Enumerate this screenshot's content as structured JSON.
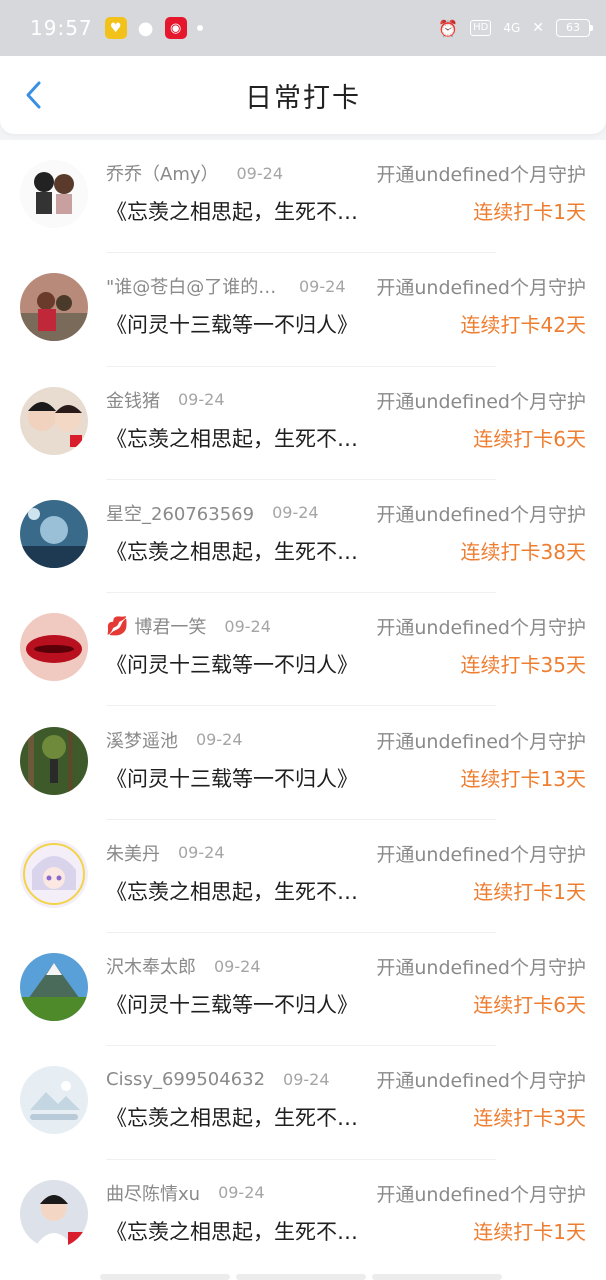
{
  "status_bar": {
    "time": "19:57",
    "network_badge": "HD",
    "signal": "4G",
    "battery": "63",
    "icons": [
      "tmall-icon",
      "wechat-icon",
      "weibo-icon",
      "alarm-icon",
      "hd-icon",
      "signal-4g-icon",
      "wifi-off-icon",
      "battery-icon"
    ]
  },
  "header": {
    "back_icon": "chevron-left-icon",
    "title": "日常打卡"
  },
  "colors": {
    "accent_back": "#3a8ee6",
    "streak": "#ee7d30",
    "muted": "#8a8a8a"
  },
  "items": [
    {
      "name": "乔乔（Amy）",
      "date": "09-24",
      "guard": "开通undefined个月守护",
      "content": "《忘羡之相思起，生死不相负》",
      "streak": "连续打卡1天"
    },
    {
      "name": "\"谁@苍白@了谁的等待",
      "date": "09-24",
      "guard": "开通undefined个月守护",
      "content": "《问灵十三载等一不归人》",
      "streak": "连续打卡42天"
    },
    {
      "name": "金钱猪",
      "date": "09-24",
      "guard": "开通undefined个月守护",
      "content": "《忘羡之相思起，生死不相负》",
      "streak": "连续打卡6天"
    },
    {
      "name": "星空_260763569",
      "date": "09-24",
      "guard": "开通undefined个月守护",
      "content": "《忘羡之相思起，生死不相负》",
      "streak": "连续打卡38天"
    },
    {
      "name": "博君一笑",
      "date": "09-24",
      "guard": "开通undefined个月守护",
      "content": "《问灵十三载等一不归人》",
      "streak": "连续打卡35天",
      "icon": "lips-icon"
    },
    {
      "name": "溪梦遥池",
      "date": "09-24",
      "guard": "开通undefined个月守护",
      "content": "《问灵十三载等一不归人》",
      "streak": "连续打卡13天"
    },
    {
      "name": "朱美丹",
      "date": "09-24",
      "guard": "开通undefined个月守护",
      "content": "《忘羡之相思起，生死不相负》",
      "streak": "连续打卡1天"
    },
    {
      "name": "沢木奉太郎",
      "date": "09-24",
      "guard": "开通undefined个月守护",
      "content": "《问灵十三载等一不归人》",
      "streak": "连续打卡6天"
    },
    {
      "name": "Cissy_699504632",
      "date": "09-24",
      "guard": "开通undefined个月守护",
      "content": "《忘羡之相思起，生死不相负》",
      "streak": "连续打卡3天"
    },
    {
      "name": "曲尽陈情xu",
      "date": "09-24",
      "guard": "开通undefined个月守护",
      "content": "《忘羡之相思起，生死不相负》",
      "streak": "连续打卡1天"
    }
  ]
}
